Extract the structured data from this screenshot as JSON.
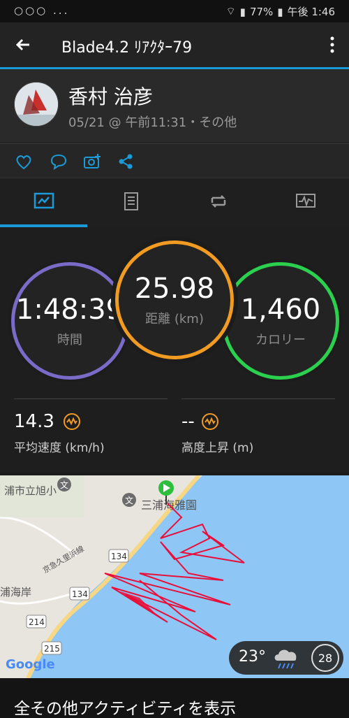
{
  "status": {
    "left": "○○○ ...",
    "battery": "77%",
    "time": "午後 1:46"
  },
  "appbar": {
    "title": "Blade4.2 ﾘｱｸﾀｰ79"
  },
  "profile": {
    "name": "香村 治彦",
    "meta": "05/21 @ 午前11:31・その他"
  },
  "tabs": [
    "summary",
    "details",
    "laps",
    "charts"
  ],
  "stats": {
    "time": {
      "value": "1:48:39",
      "label": "時間"
    },
    "distance": {
      "value": "25.98",
      "label": "距離 (km)"
    },
    "calories": {
      "value": "1,460",
      "label": "カロリー"
    }
  },
  "metrics": [
    {
      "value": "14.3",
      "label": "平均速度 (km/h)"
    },
    {
      "value": "--",
      "label": "高度上昇 (m)"
    }
  ],
  "map": {
    "labels": [
      "浦市立旭小",
      "三浦海雅園",
      "浦海岸",
      "134",
      "134",
      "214",
      "215",
      "Google"
    ],
    "road_label": "京急久里浜線"
  },
  "weather": {
    "temp": "23°",
    "wind": "28"
  },
  "footer": {
    "link": "全その他アクティビティを表示"
  },
  "colors": {
    "accent": "#1a9bd8",
    "time": "#7b6bc8",
    "distance": "#f29b22",
    "calories": "#2bd04f"
  }
}
